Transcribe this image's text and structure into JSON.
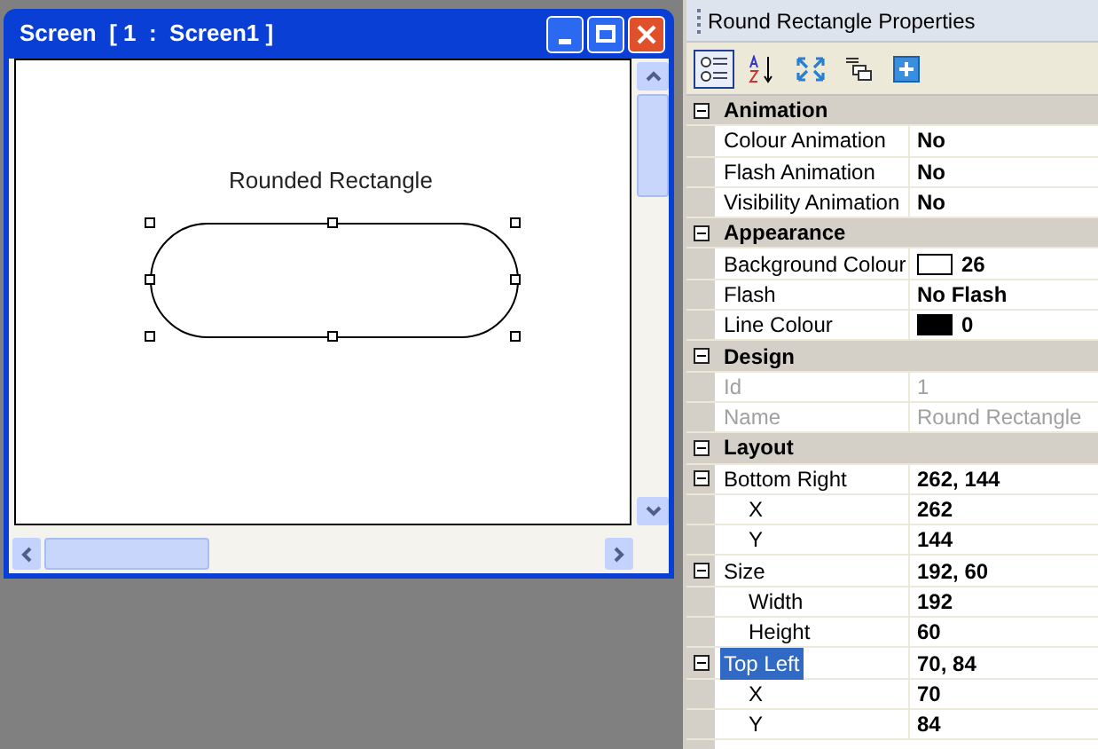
{
  "screen_window": {
    "title": "Screen  [ 1  :  Screen1 ]",
    "shape_label": "Rounded Rectangle"
  },
  "properties_panel": {
    "title": "Round Rectangle Properties",
    "toolbar": [
      {
        "kind": "categorized",
        "selected": true
      },
      {
        "kind": "alphabetical",
        "selected": false
      },
      {
        "kind": "expand",
        "selected": false
      },
      {
        "kind": "pages",
        "selected": false
      },
      {
        "kind": "add",
        "selected": false
      }
    ],
    "categories": [
      {
        "name": "Animation",
        "expanded": true,
        "items": [
          {
            "name": "Colour Animation",
            "value": "No",
            "disabled": false,
            "selected": false
          },
          {
            "name": "Flash Animation",
            "value": "No",
            "disabled": false,
            "selected": false
          },
          {
            "name": "Visibility Animation",
            "value": "No",
            "disabled": false,
            "selected": false
          }
        ]
      },
      {
        "name": "Appearance",
        "expanded": true,
        "items": [
          {
            "name": "Background Colour",
            "value": "26",
            "color": "#ffffff",
            "disabled": false,
            "selected": false
          },
          {
            "name": "Flash",
            "value": "No Flash",
            "disabled": false,
            "selected": false
          },
          {
            "name": "Line Colour",
            "value": "0",
            "color": "#000000",
            "disabled": false,
            "selected": false
          }
        ]
      },
      {
        "name": "Design",
        "expanded": true,
        "items": [
          {
            "name": "Id",
            "value": "1",
            "disabled": true,
            "selected": false
          },
          {
            "name": "Name",
            "value": "Round Rectangle",
            "disabled": true,
            "selected": false
          }
        ]
      },
      {
        "name": "Layout",
        "expanded": true,
        "items": [
          {
            "name": "Bottom Right",
            "value": "262, 144",
            "disabled": false,
            "selected": false,
            "expanded": true,
            "children": [
              {
                "name": "X",
                "value": "262"
              },
              {
                "name": "Y",
                "value": "144"
              }
            ]
          },
          {
            "name": "Size",
            "value": "192, 60",
            "disabled": false,
            "selected": false,
            "expanded": true,
            "children": [
              {
                "name": "Width",
                "value": "192"
              },
              {
                "name": "Height",
                "value": "60"
              }
            ]
          },
          {
            "name": "Top Left",
            "value": "70, 84",
            "disabled": false,
            "selected": true,
            "expanded": true,
            "children": [
              {
                "name": "X",
                "value": "70"
              },
              {
                "name": "Y",
                "value": "84"
              }
            ]
          }
        ]
      }
    ]
  }
}
